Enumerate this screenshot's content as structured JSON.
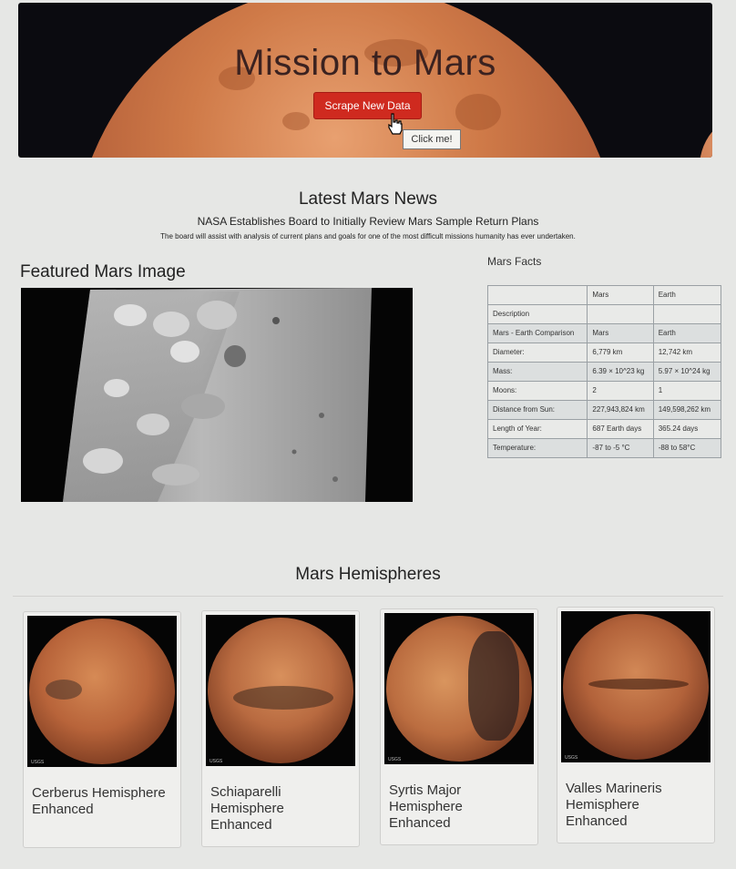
{
  "header": {
    "title": "Mission to Mars",
    "scrape_button": "Scrape New Data",
    "tooltip": "Click me!"
  },
  "news": {
    "heading": "Latest Mars News",
    "title": "NASA Establishes Board to Initially Review Mars Sample Return Plans",
    "paragraph": "The board will assist with analysis of current plans and goals for one of the most difficult missions humanity has ever undertaken."
  },
  "featured": {
    "heading": "Featured Mars Image"
  },
  "facts": {
    "heading": "Mars Facts",
    "columns": [
      "",
      "Mars",
      "Earth"
    ],
    "rows": [
      [
        "Description",
        "",
        ""
      ],
      [
        "Mars - Earth Comparison",
        "Mars",
        "Earth"
      ],
      [
        "Diameter:",
        "6,779 km",
        "12,742 km"
      ],
      [
        "Mass:",
        "6.39 × 10^23 kg",
        "5.97 × 10^24 kg"
      ],
      [
        "Moons:",
        "2",
        "1"
      ],
      [
        "Distance from Sun:",
        "227,943,824 km",
        "149,598,262 km"
      ],
      [
        "Length of Year:",
        "687 Earth days",
        "365.24 days"
      ],
      [
        "Temperature:",
        "-87 to -5 °C",
        "-88 to 58°C"
      ]
    ]
  },
  "hemispheres": {
    "heading": "Mars Hemispheres",
    "items": [
      {
        "title": "Cerberus Hemisphere Enhanced",
        "logo": "USGS"
      },
      {
        "title": "Schiaparelli Hemisphere Enhanced",
        "logo": "USGS"
      },
      {
        "title": "Syrtis Major Hemisphere Enhanced",
        "logo": "USGS"
      },
      {
        "title": "Valles Marineris Hemisphere Enhanced",
        "logo": "USGS"
      }
    ]
  },
  "colors": {
    "button": "#cf2a1f",
    "background": "#e6e7e5"
  },
  "icons": {
    "cursor": "hand-pointer-icon"
  }
}
